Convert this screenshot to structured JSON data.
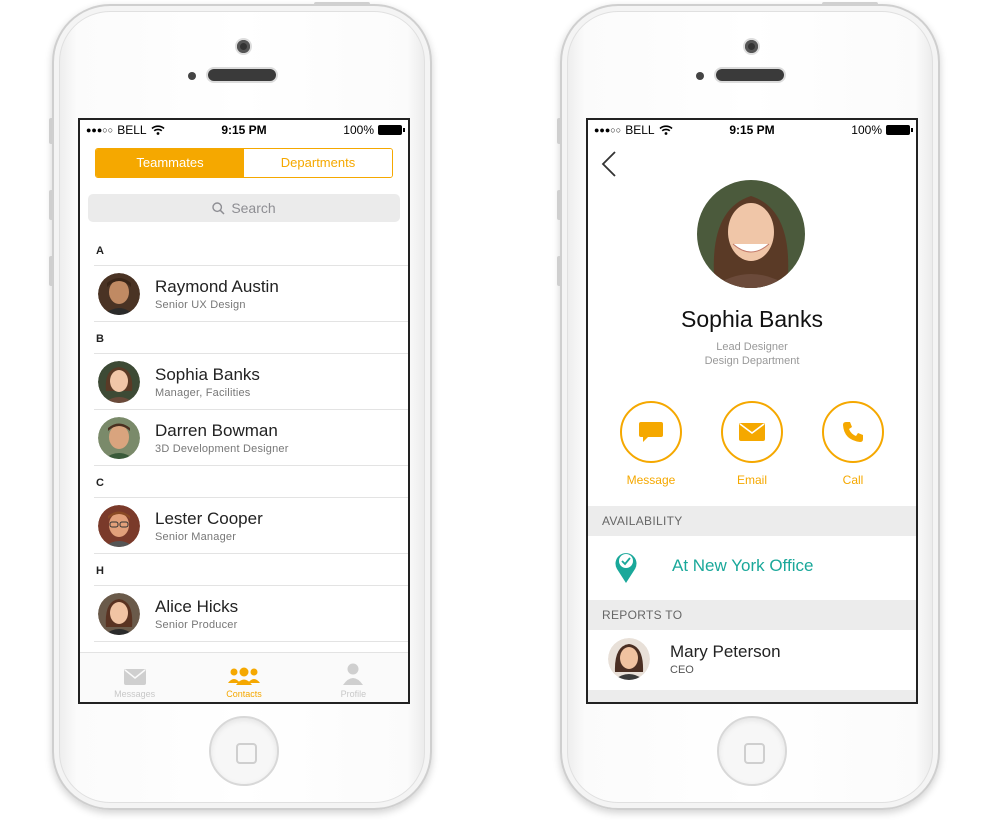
{
  "status_bar": {
    "carrier": "BELL",
    "time": "9:15 PM",
    "battery": "100%"
  },
  "contacts_screen": {
    "segments": [
      "Teammates",
      "Departments"
    ],
    "search_placeholder": "Search",
    "sections": [
      {
        "letter": "A",
        "contacts": [
          {
            "name": "Raymond Austin",
            "title": "Senior UX Design"
          }
        ]
      },
      {
        "letter": "B",
        "contacts": [
          {
            "name": "Sophia Banks",
            "title": "Manager, Facilities"
          },
          {
            "name": "Darren Bowman",
            "title": "3D Development Designer"
          }
        ]
      },
      {
        "letter": "C",
        "contacts": [
          {
            "name": "Lester Cooper",
            "title": "Senior Manager"
          }
        ]
      },
      {
        "letter": "H",
        "contacts": [
          {
            "name": "Alice Hicks",
            "title": "Senior Producer"
          }
        ]
      }
    ],
    "tabs": [
      "Messages",
      "Contacts",
      "Profile"
    ]
  },
  "profile_screen": {
    "name": "Sophia Banks",
    "role": "Lead Designer",
    "department": "Design Department",
    "actions": [
      "Message",
      "Email",
      "Call"
    ],
    "availability_header": "AVAILABILITY",
    "availability": "At New York Office",
    "reports_to_header": "REPORTS TO",
    "reports_to": {
      "name": "Mary Peterson",
      "title": "CEO"
    }
  },
  "colors": {
    "accent": "#f5a800",
    "availability": "#1aa89a",
    "section_bg": "#ececec"
  }
}
